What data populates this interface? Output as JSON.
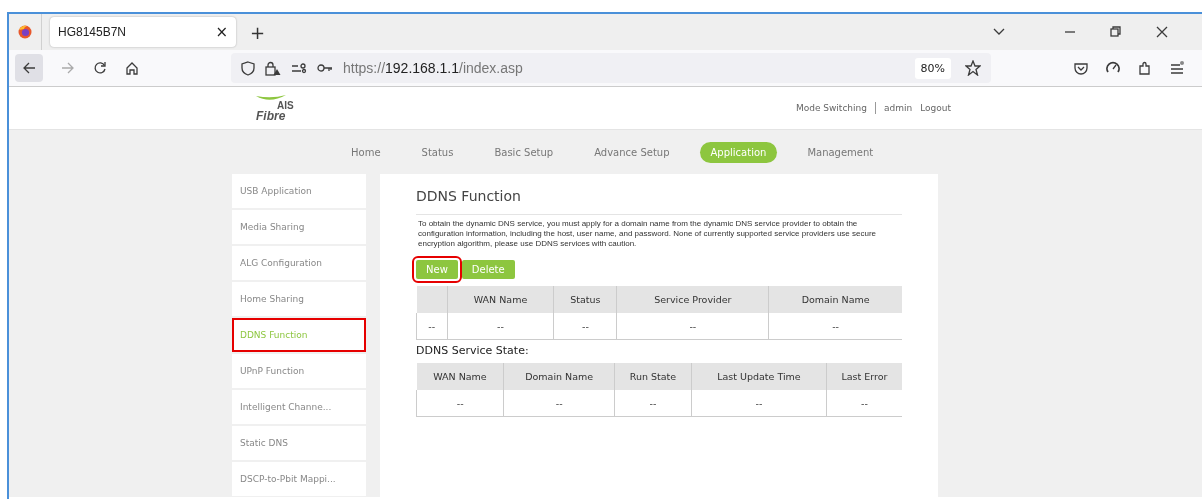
{
  "browser": {
    "tab_title": "HG8145B7N",
    "tab_close": "×",
    "new_tab": "+",
    "url_scheme": "https://",
    "url_host": "192.168.1.1",
    "url_path": "/index.asp",
    "zoom": "80%"
  },
  "header": {
    "logo_top": "AIS",
    "logo_bottom": "Fibre",
    "links": [
      "Mode Switching",
      "admin",
      "Logout"
    ]
  },
  "nav": [
    {
      "label": "Home",
      "selected": false
    },
    {
      "label": "Status",
      "selected": false
    },
    {
      "label": "Basic Setup",
      "selected": false
    },
    {
      "label": "Advance Setup",
      "selected": false
    },
    {
      "label": "Application",
      "selected": true
    },
    {
      "label": "Management",
      "selected": false
    }
  ],
  "sidebar": {
    "items": [
      {
        "label": "USB Application",
        "selected": false,
        "highlighted": false
      },
      {
        "label": "Media Sharing",
        "selected": false,
        "highlighted": false
      },
      {
        "label": "ALG Configuration",
        "selected": false,
        "highlighted": false
      },
      {
        "label": "Home Sharing",
        "selected": false,
        "highlighted": false
      },
      {
        "label": "DDNS Function",
        "selected": true,
        "highlighted": true
      },
      {
        "label": "UPnP Function",
        "selected": false,
        "highlighted": false
      },
      {
        "label": "Intelligent Channe...",
        "selected": false,
        "highlighted": false
      },
      {
        "label": "Static DNS",
        "selected": false,
        "highlighted": false
      },
      {
        "label": "DSCP-to-Pbit Mappi...",
        "selected": false,
        "highlighted": false
      }
    ]
  },
  "content": {
    "title": "DDNS Function",
    "description": "To obtain the dynamic DNS service, you must apply for a domain name from the dynamic DNS service provider to obtain the configuration information, including the host, user name, and password. None of currently supported service providers use secure encryption algorithm, please use DDNS services with caution.",
    "buttons": [
      {
        "label": "New",
        "highlighted": true
      },
      {
        "label": "Delete",
        "highlighted": false
      }
    ],
    "ddns_table": {
      "columns": [
        "",
        "WAN Name",
        "Status",
        "Service Provider",
        "Domain Name"
      ],
      "rows": [
        [
          "--",
          "--",
          "--",
          "--",
          "--"
        ]
      ]
    },
    "state_title": "DDNS Service State:",
    "state_table": {
      "columns": [
        "WAN Name",
        "Domain Name",
        "Run State",
        "Last Update Time",
        "Last Error"
      ],
      "rows": [
        [
          "--",
          "--",
          "--",
          "--",
          "--"
        ]
      ]
    }
  }
}
